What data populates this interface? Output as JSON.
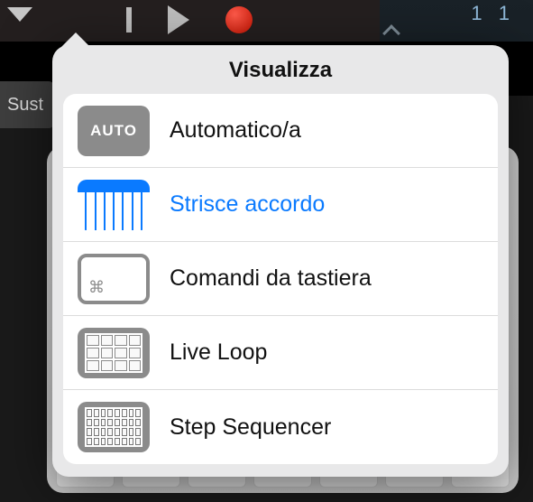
{
  "background": {
    "sustain_label": "Sust",
    "position_display": "1  1"
  },
  "popover": {
    "title": "Visualizza",
    "options": [
      {
        "id": "auto",
        "label": "Automatico/a",
        "icon_text": "AUTO",
        "selected": false
      },
      {
        "id": "chord",
        "label": "Strisce accordo",
        "icon_text": "",
        "selected": true
      },
      {
        "id": "cmd",
        "label": "Comandi da tastiera",
        "icon_text": "⌘",
        "selected": false
      },
      {
        "id": "loop",
        "label": "Live Loop",
        "icon_text": "",
        "selected": false
      },
      {
        "id": "step",
        "label": "Step Sequencer",
        "icon_text": "",
        "selected": false
      }
    ]
  },
  "colors": {
    "accent": "#0a7aff",
    "popover_bg": "#e8e8e9",
    "icon_gray": "#8b8b8b"
  }
}
